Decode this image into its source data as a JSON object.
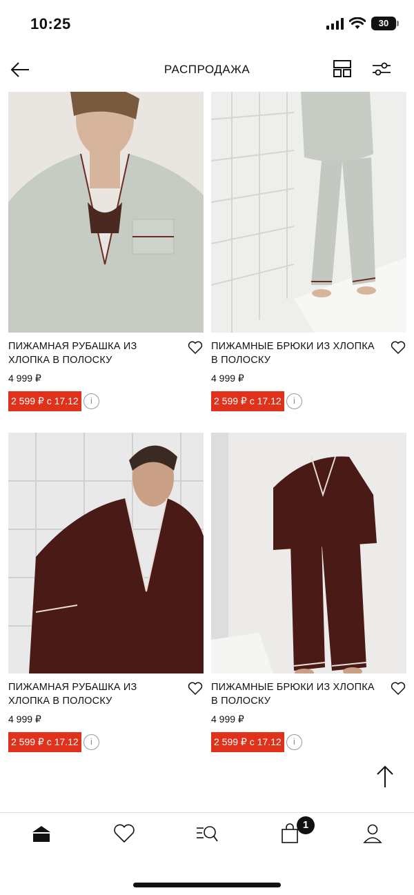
{
  "status_bar": {
    "time": "10:25",
    "battery": "30"
  },
  "header": {
    "title": "РАСПРОДАЖА"
  },
  "products": [
    {
      "name": "ПИЖАМНАЯ РУБАШКА ИЗ ХЛОПКА В ПОЛОСКУ",
      "old_price": "4 999 ₽",
      "sale": "2 599 ₽ с 17.12",
      "info": "i"
    },
    {
      "name": "ПИЖАМНЫЕ БРЮКИ ИЗ ХЛОПКА В ПОЛОСКУ",
      "old_price": "4 999 ₽",
      "sale": "2 599 ₽ с 17.12",
      "info": "i"
    },
    {
      "name": "ПИЖАМНАЯ РУБАШКА ИЗ ХЛОПКА В ПОЛОСКУ",
      "old_price": "4 999 ₽",
      "sale": "2 599 ₽ с 17.12",
      "info": "i"
    },
    {
      "name": "ПИЖАМНЫЕ БРЮКИ ИЗ ХЛОПКА В ПОЛОСКУ",
      "old_price": "4 999 ₽",
      "sale": "2 599 ₽ с 17.12",
      "info": "i"
    }
  ],
  "bottom_nav": {
    "items": [
      "home-icon",
      "heart-icon",
      "search-icon",
      "bag-icon",
      "profile-icon"
    ],
    "cart_count": "1"
  },
  "colors": {
    "sale": "#e0321a",
    "text": "#111111",
    "grey_pajama": "#c9cfc8",
    "brown_pajama": "#4a1a17"
  }
}
